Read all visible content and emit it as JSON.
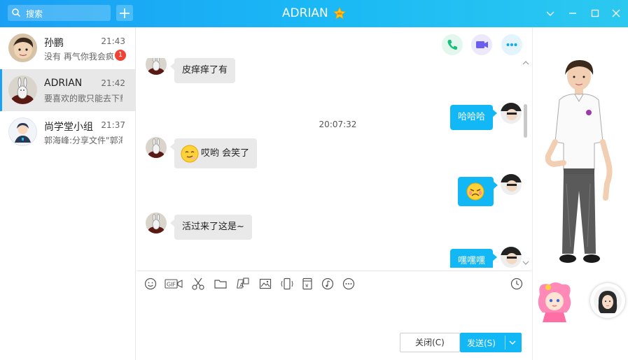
{
  "colors": {
    "accent": "#12b7f5",
    "titlebar": "#1ab8f5",
    "badge": "#f04134"
  },
  "titlebar": {
    "title": "ADRIAN",
    "search_placeholder": "搜索"
  },
  "conversations": [
    {
      "name": "孙鹏",
      "time": "21:43",
      "preview": "没有 再气你我会疯",
      "badge": "1"
    },
    {
      "name": "ADRIAN",
      "time": "21:42",
      "preview": "要喜欢的歌只能去下载",
      "active": true
    },
    {
      "name": "尚学堂小组",
      "time": "21:37",
      "preview": "郭海峰:分享文件\"郭海峰\""
    }
  ],
  "chat": {
    "messages": [
      {
        "side": "left",
        "text": "皮痒痒了有"
      },
      {
        "side": "right",
        "text": "哈哈哈"
      },
      {
        "side": "left",
        "text": "哎哟 会笑了",
        "emoji": "smirk"
      },
      {
        "side": "right",
        "emoji": "cry"
      },
      {
        "side": "left",
        "text": "活过来了这是~"
      },
      {
        "side": "right",
        "text": "嘿嘿嘿"
      }
    ],
    "timestamp": "20:07:32",
    "close_label": "关闭(C)",
    "send_label": "发送(S)"
  },
  "toolbar_icons": [
    "emoji-icon",
    "gif-icon",
    "scissors-icon",
    "folder-icon",
    "font-icon",
    "image-icon",
    "vibrate-icon",
    "money-icon",
    "music-icon",
    "more-icon",
    "history-icon"
  ]
}
